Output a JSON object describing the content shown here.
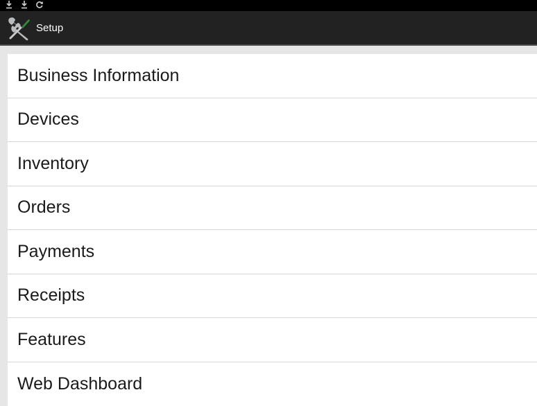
{
  "status_bar": {
    "icons": [
      "download-icon",
      "download-icon",
      "sync-icon"
    ]
  },
  "action_bar": {
    "title": "Setup",
    "icon": "wrench-screwdriver-icon"
  },
  "settings": {
    "items": [
      {
        "label": "Business Information"
      },
      {
        "label": "Devices"
      },
      {
        "label": "Inventory"
      },
      {
        "label": "Orders"
      },
      {
        "label": "Payments"
      },
      {
        "label": "Receipts"
      },
      {
        "label": "Features"
      },
      {
        "label": "Web Dashboard"
      }
    ]
  },
  "colors": {
    "status_bar_bg": "#000000",
    "action_bar_bg": "#222222",
    "list_bg": "#ffffff",
    "page_bg": "#e6e6e6",
    "divider": "#d7d7d7",
    "text": "#1a1a1a",
    "icon_green": "#2e8b3a"
  }
}
